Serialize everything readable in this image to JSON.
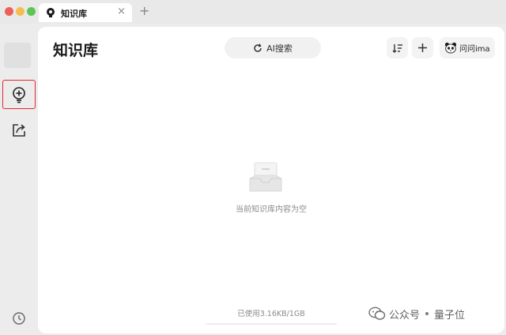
{
  "window": {
    "tab_title": "知识库",
    "tab_close": "×",
    "new_tab": "+"
  },
  "sidebar": {
    "items": [
      {
        "name": "knowledge-base",
        "icon": "bulb-plus-icon",
        "selected": true
      },
      {
        "name": "share",
        "icon": "share-arrow-icon"
      },
      {
        "name": "history",
        "icon": "clock-icon"
      }
    ]
  },
  "header": {
    "title": "知识库",
    "search_label": "AI搜索",
    "ima_label": "问问ima"
  },
  "content": {
    "empty_message": "当前知识库内容为空",
    "usage_label": "已使用3.16KB/1GB",
    "usage_fraction": 3e-06
  },
  "watermark": {
    "text_left": "公众号",
    "text_right": "量子位"
  },
  "colors": {
    "accent": "#4a7cf7",
    "highlight_border": "#e0282e"
  }
}
